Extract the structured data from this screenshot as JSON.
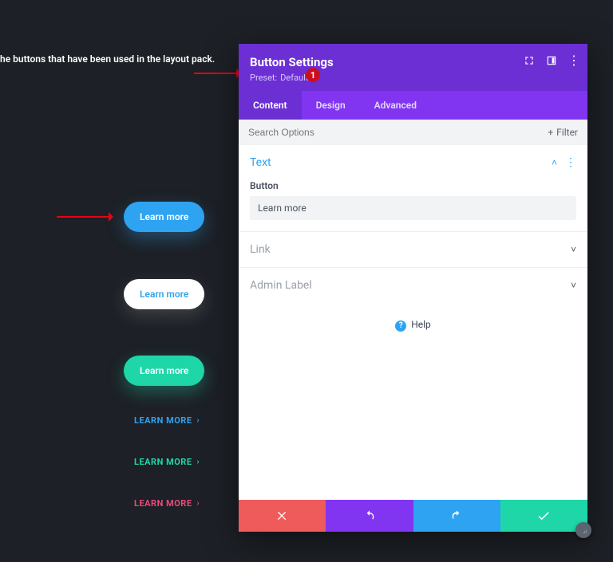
{
  "page_text": "he buttons that have been used in the layout pack.",
  "annotation_badge": "1",
  "preview_buttons": {
    "blue": "Learn more",
    "white": "Learn more",
    "teal": "Learn more",
    "link_blue": "LEARN MORE",
    "link_teal": "LEARN MORE",
    "link_pink": "LEARN MORE"
  },
  "modal": {
    "title": "Button Settings",
    "preset_label": "Preset:",
    "preset_value": "Default",
    "tabs": {
      "content": "Content",
      "design": "Design",
      "advanced": "Advanced"
    },
    "search_placeholder": "Search Options",
    "filter_label": "Filter",
    "sections": {
      "text": {
        "title": "Text",
        "field_label": "Button",
        "field_value": "Learn more"
      },
      "link": {
        "title": "Link"
      },
      "admin_label": {
        "title": "Admin Label"
      }
    },
    "help_label": "Help"
  },
  "colors": {
    "purple_dark": "#6b2fd4",
    "purple": "#8135f1",
    "blue": "#2ea3f2",
    "teal": "#1fd6a8",
    "red": "#ef5b5b",
    "pink": "#e94a7a",
    "bg": "#1d2026"
  }
}
